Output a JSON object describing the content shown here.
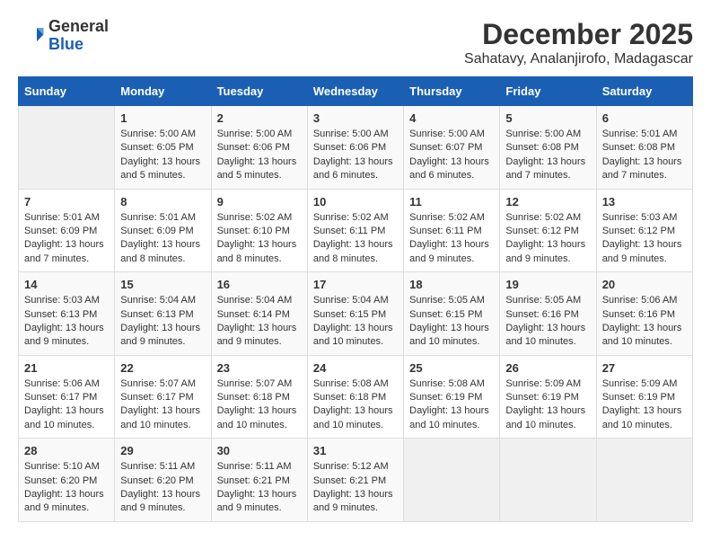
{
  "header": {
    "logo": {
      "line1": "General",
      "line2": "Blue"
    },
    "title": "December 2025",
    "subtitle": "Sahatavy, Analanjirofo, Madagascar"
  },
  "calendar": {
    "days_of_week": [
      "Sunday",
      "Monday",
      "Tuesday",
      "Wednesday",
      "Thursday",
      "Friday",
      "Saturday"
    ],
    "weeks": [
      [
        {
          "day": "",
          "empty": true
        },
        {
          "day": "1",
          "sunrise": "Sunrise: 5:00 AM",
          "sunset": "Sunset: 6:05 PM",
          "daylight": "Daylight: 13 hours and 5 minutes."
        },
        {
          "day": "2",
          "sunrise": "Sunrise: 5:00 AM",
          "sunset": "Sunset: 6:06 PM",
          "daylight": "Daylight: 13 hours and 5 minutes."
        },
        {
          "day": "3",
          "sunrise": "Sunrise: 5:00 AM",
          "sunset": "Sunset: 6:06 PM",
          "daylight": "Daylight: 13 hours and 6 minutes."
        },
        {
          "day": "4",
          "sunrise": "Sunrise: 5:00 AM",
          "sunset": "Sunset: 6:07 PM",
          "daylight": "Daylight: 13 hours and 6 minutes."
        },
        {
          "day": "5",
          "sunrise": "Sunrise: 5:00 AM",
          "sunset": "Sunset: 6:08 PM",
          "daylight": "Daylight: 13 hours and 7 minutes."
        },
        {
          "day": "6",
          "sunrise": "Sunrise: 5:01 AM",
          "sunset": "Sunset: 6:08 PM",
          "daylight": "Daylight: 13 hours and 7 minutes."
        }
      ],
      [
        {
          "day": "7",
          "sunrise": "Sunrise: 5:01 AM",
          "sunset": "Sunset: 6:09 PM",
          "daylight": "Daylight: 13 hours and 7 minutes."
        },
        {
          "day": "8",
          "sunrise": "Sunrise: 5:01 AM",
          "sunset": "Sunset: 6:09 PM",
          "daylight": "Daylight: 13 hours and 8 minutes."
        },
        {
          "day": "9",
          "sunrise": "Sunrise: 5:02 AM",
          "sunset": "Sunset: 6:10 PM",
          "daylight": "Daylight: 13 hours and 8 minutes."
        },
        {
          "day": "10",
          "sunrise": "Sunrise: 5:02 AM",
          "sunset": "Sunset: 6:11 PM",
          "daylight": "Daylight: 13 hours and 8 minutes."
        },
        {
          "day": "11",
          "sunrise": "Sunrise: 5:02 AM",
          "sunset": "Sunset: 6:11 PM",
          "daylight": "Daylight: 13 hours and 9 minutes."
        },
        {
          "day": "12",
          "sunrise": "Sunrise: 5:02 AM",
          "sunset": "Sunset: 6:12 PM",
          "daylight": "Daylight: 13 hours and 9 minutes."
        },
        {
          "day": "13",
          "sunrise": "Sunrise: 5:03 AM",
          "sunset": "Sunset: 6:12 PM",
          "daylight": "Daylight: 13 hours and 9 minutes."
        }
      ],
      [
        {
          "day": "14",
          "sunrise": "Sunrise: 5:03 AM",
          "sunset": "Sunset: 6:13 PM",
          "daylight": "Daylight: 13 hours and 9 minutes."
        },
        {
          "day": "15",
          "sunrise": "Sunrise: 5:04 AM",
          "sunset": "Sunset: 6:13 PM",
          "daylight": "Daylight: 13 hours and 9 minutes."
        },
        {
          "day": "16",
          "sunrise": "Sunrise: 5:04 AM",
          "sunset": "Sunset: 6:14 PM",
          "daylight": "Daylight: 13 hours and 9 minutes."
        },
        {
          "day": "17",
          "sunrise": "Sunrise: 5:04 AM",
          "sunset": "Sunset: 6:15 PM",
          "daylight": "Daylight: 13 hours and 10 minutes."
        },
        {
          "day": "18",
          "sunrise": "Sunrise: 5:05 AM",
          "sunset": "Sunset: 6:15 PM",
          "daylight": "Daylight: 13 hours and 10 minutes."
        },
        {
          "day": "19",
          "sunrise": "Sunrise: 5:05 AM",
          "sunset": "Sunset: 6:16 PM",
          "daylight": "Daylight: 13 hours and 10 minutes."
        },
        {
          "day": "20",
          "sunrise": "Sunrise: 5:06 AM",
          "sunset": "Sunset: 6:16 PM",
          "daylight": "Daylight: 13 hours and 10 minutes."
        }
      ],
      [
        {
          "day": "21",
          "sunrise": "Sunrise: 5:06 AM",
          "sunset": "Sunset: 6:17 PM",
          "daylight": "Daylight: 13 hours and 10 minutes."
        },
        {
          "day": "22",
          "sunrise": "Sunrise: 5:07 AM",
          "sunset": "Sunset: 6:17 PM",
          "daylight": "Daylight: 13 hours and 10 minutes."
        },
        {
          "day": "23",
          "sunrise": "Sunrise: 5:07 AM",
          "sunset": "Sunset: 6:18 PM",
          "daylight": "Daylight: 13 hours and 10 minutes."
        },
        {
          "day": "24",
          "sunrise": "Sunrise: 5:08 AM",
          "sunset": "Sunset: 6:18 PM",
          "daylight": "Daylight: 13 hours and 10 minutes."
        },
        {
          "day": "25",
          "sunrise": "Sunrise: 5:08 AM",
          "sunset": "Sunset: 6:19 PM",
          "daylight": "Daylight: 13 hours and 10 minutes."
        },
        {
          "day": "26",
          "sunrise": "Sunrise: 5:09 AM",
          "sunset": "Sunset: 6:19 PM",
          "daylight": "Daylight: 13 hours and 10 minutes."
        },
        {
          "day": "27",
          "sunrise": "Sunrise: 5:09 AM",
          "sunset": "Sunset: 6:19 PM",
          "daylight": "Daylight: 13 hours and 10 minutes."
        }
      ],
      [
        {
          "day": "28",
          "sunrise": "Sunrise: 5:10 AM",
          "sunset": "Sunset: 6:20 PM",
          "daylight": "Daylight: 13 hours and 9 minutes."
        },
        {
          "day": "29",
          "sunrise": "Sunrise: 5:11 AM",
          "sunset": "Sunset: 6:20 PM",
          "daylight": "Daylight: 13 hours and 9 minutes."
        },
        {
          "day": "30",
          "sunrise": "Sunrise: 5:11 AM",
          "sunset": "Sunset: 6:21 PM",
          "daylight": "Daylight: 13 hours and 9 minutes."
        },
        {
          "day": "31",
          "sunrise": "Sunrise: 5:12 AM",
          "sunset": "Sunset: 6:21 PM",
          "daylight": "Daylight: 13 hours and 9 minutes."
        },
        {
          "day": "",
          "empty": true
        },
        {
          "day": "",
          "empty": true
        },
        {
          "day": "",
          "empty": true
        }
      ]
    ]
  }
}
